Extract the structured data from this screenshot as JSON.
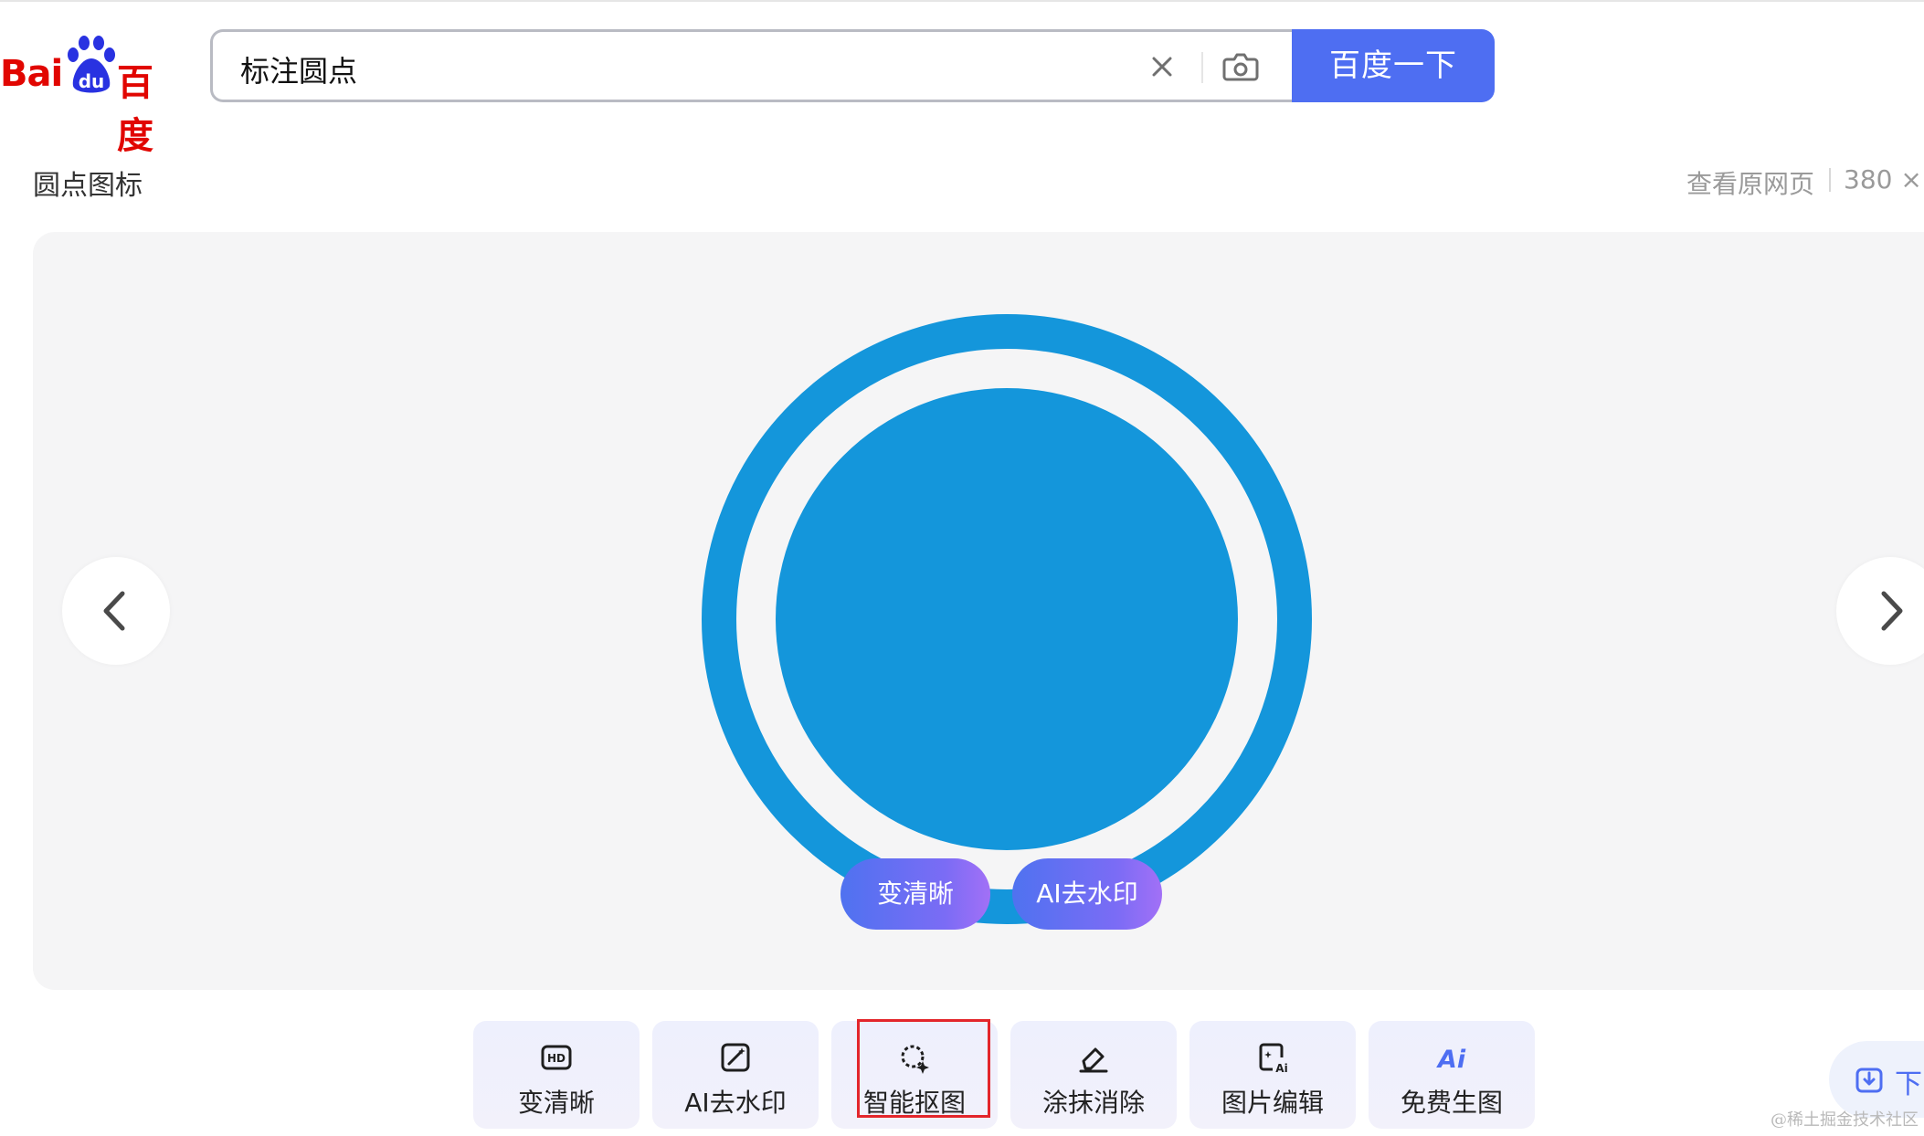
{
  "logo": {
    "left_text": "Bai",
    "paw_text": "du",
    "right_text": "百度"
  },
  "search": {
    "query": "标注圆点",
    "submit_label": "百度一下"
  },
  "image_header": {
    "title": "圆点图标",
    "source_link": "查看原网页",
    "dimensions": "380 ×"
  },
  "viewer": {
    "overlay_buttons": [
      "变清晰",
      "AI去水印"
    ]
  },
  "toolbar": {
    "tools": [
      {
        "label": "变清晰",
        "icon": "hd-icon"
      },
      {
        "label": "AI去水印",
        "icon": "magic-wand-icon"
      },
      {
        "label": "智能抠图",
        "icon": "smart-cutout-icon"
      },
      {
        "label": "涂抹消除",
        "icon": "eraser-icon"
      },
      {
        "label": "图片编辑",
        "icon": "ai-image-edit-icon"
      },
      {
        "label": "免费生图",
        "icon": "ai-generate-icon"
      }
    ]
  },
  "download": {
    "label": "下"
  },
  "watermark": "@稀土掘金技术社区",
  "colors": {
    "brand_blue": "#4e6ef2",
    "logo_red": "#e10601",
    "graphic_blue": "#1496db",
    "highlight_red": "#e3262b"
  }
}
